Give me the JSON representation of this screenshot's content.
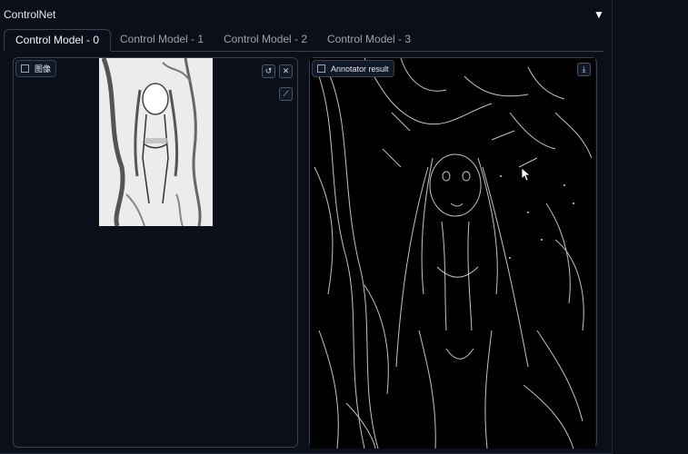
{
  "panel": {
    "title": "ControlNet",
    "toggle_icon": "▼"
  },
  "tabs": [
    {
      "label": "Control Model - 0",
      "active": true
    },
    {
      "label": "Control Model - 1",
      "active": false
    },
    {
      "label": "Control Model - 2",
      "active": false
    },
    {
      "label": "Control Model - 3",
      "active": false
    }
  ],
  "input_image": {
    "label": "图像"
  },
  "annotator": {
    "label": "Annotator result"
  },
  "icons": {
    "image_label": "image-icon",
    "reset": "rotate-ccw-icon",
    "clear": "close-icon",
    "edit": "brush-icon",
    "download": "download-icon"
  }
}
